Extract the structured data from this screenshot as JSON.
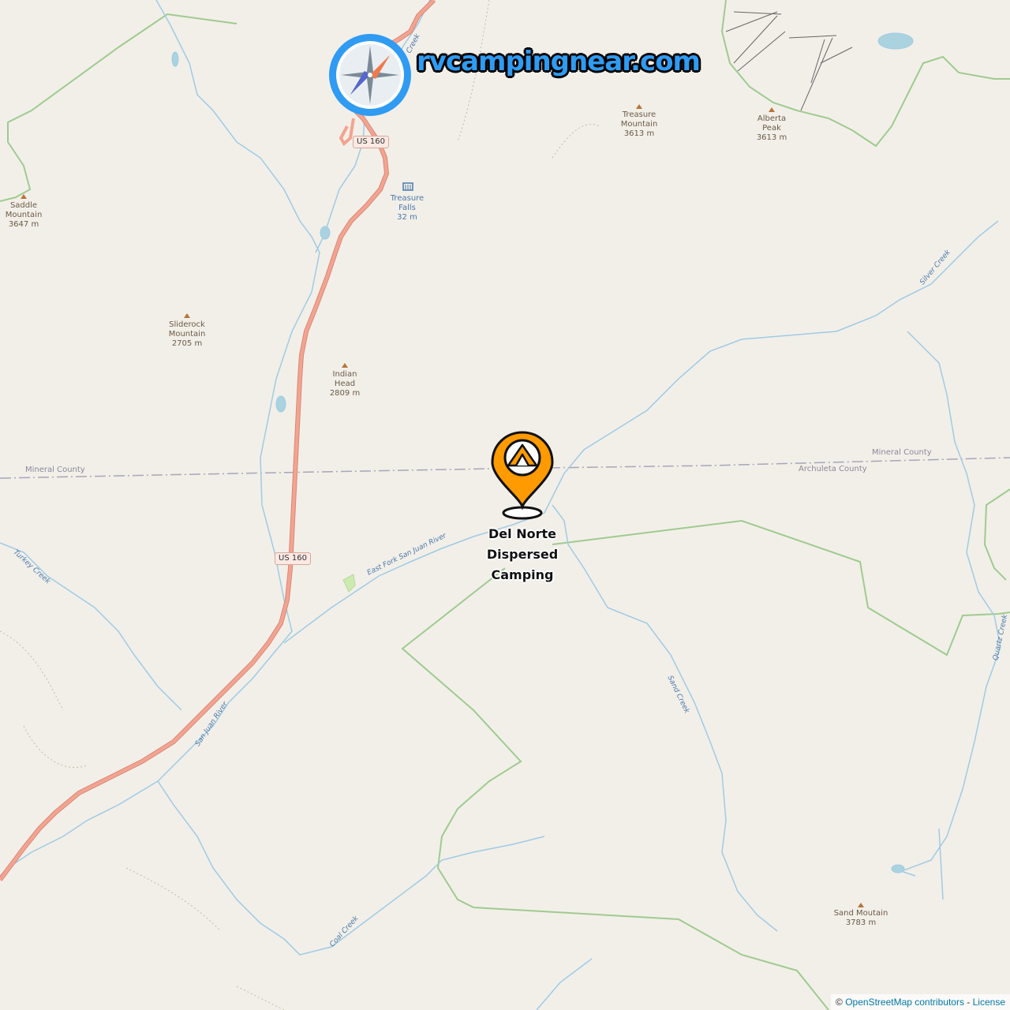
{
  "brand": {
    "text": "rvcampingnear.com"
  },
  "icons": {
    "compass": "compass-logo-icon",
    "pin": "tent-map-pin-icon"
  },
  "colors": {
    "land": "#f2efe9",
    "water": "#9fcbe3",
    "road": "#e8927c",
    "boundary": "#9fcb8f",
    "pin": "#ff9a00",
    "brand": "#2f9bf2"
  },
  "campsite": {
    "name": "Del Norte\nDispersed\nCamping"
  },
  "peaks": [
    {
      "id": "saddle",
      "label": "Saddle\nMountain\n3647 m"
    },
    {
      "id": "treasure",
      "label": "Treasure\nMountain\n3613 m"
    },
    {
      "id": "alberta",
      "label": "Alberta\nPeak\n3613 m"
    },
    {
      "id": "sliderock",
      "label": "Sliderock\nMountain\n2705 m"
    },
    {
      "id": "indianhead",
      "label": "Indian\nHead\n2809 m"
    },
    {
      "id": "sand",
      "label": "Sand Moutain\n3783 m"
    }
  ],
  "waterfall": {
    "label": "Treasure\nFalls\n32 m"
  },
  "roads": {
    "north": "US 160",
    "south": "US 160"
  },
  "counties": {
    "west": "Mineral County",
    "east_north": "Mineral County",
    "east_south": "Archuleta County"
  },
  "streams": {
    "silver": "Silver Creek",
    "east_fork": "East Fork San Juan River",
    "turkey": "Turkey Creek",
    "san_juan": "San Juan River",
    "sand": "Sand Creek",
    "quartz": "Quartz Creek",
    "coal": "Coal Creek",
    "creek_top": "Creek"
  },
  "attribution": {
    "prefix": "© ",
    "osm": "OpenStreetMap contributors",
    "sep": " - ",
    "license": "License"
  }
}
